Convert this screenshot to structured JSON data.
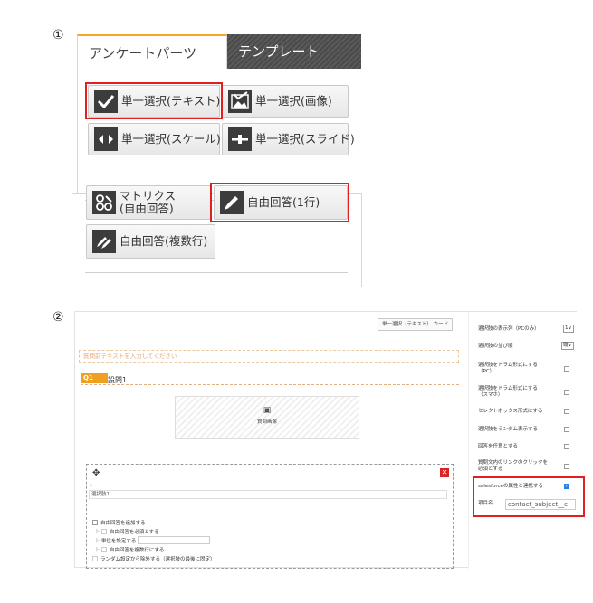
{
  "steps": [
    "①",
    "②"
  ],
  "part_panel": {
    "tabs": [
      {
        "label": "アンケートパーツ",
        "active": true
      },
      {
        "label": "テンプレート",
        "active": false
      }
    ],
    "parts": [
      {
        "label": "単一選択(テキスト)",
        "icon": "check-icon"
      },
      {
        "label": "単一選択(画像)",
        "icon": "image-check-icon"
      },
      {
        "label": "単一選択(スケール)",
        "icon": "scale-icon"
      },
      {
        "label": "単一選択(スライド)",
        "icon": "slider-icon"
      },
      {
        "label_line1": "マトリクス",
        "label_line2": "(自由回答)",
        "icon": "matrix-icon"
      },
      {
        "label": "自由回答(1行)",
        "icon": "pen-icon"
      },
      {
        "label": "自由回答(複数行)",
        "icon": "pens-icon"
      }
    ],
    "highlight_color": "#e02020"
  },
  "editor": {
    "type_button": "単一選択（テキスト） カード",
    "pre_text_placeholder": "質問前テキストを入力してください",
    "question_badge": "Q1",
    "question_title": "設問1",
    "question_image_label": "質問画像",
    "choice_number": "1",
    "choice_value": "選択肢1",
    "options": {
      "add_free": "自由回答を追加する",
      "free_required": "自由回答を必須とする",
      "set_unit": "単位を設定する",
      "free_multiline": "自由回答を複数行にする",
      "exclude_random": "ランダム設定から除外する（選択肢の最後に固定）",
      "prefix": "|-"
    }
  },
  "settings": {
    "rows": [
      {
        "label": "選択肢の表示列（PCのみ）",
        "select": "1",
        "chevron": "∨"
      },
      {
        "label": "選択肢の並び順",
        "select": "縦",
        "chevron": "∨"
      },
      {
        "label": "選択肢をドラム形式にする（PC）",
        "checked": false
      },
      {
        "label": "選択肢をドラム形式にする（スマホ）",
        "checked": false
      },
      {
        "label": "セレクトボックス形式にする",
        "checked": false
      },
      {
        "label": "選択肢をランダム表示する",
        "checked": false
      },
      {
        "label": "回答を任意とする",
        "checked": false
      },
      {
        "label": "質問文内のリンクのクリックを必須とする",
        "checked": false
      },
      {
        "label": "salesforceの属性と連携する",
        "checked": true
      }
    ],
    "item_name_label": "項目名",
    "item_name_value": "contact_subject__c"
  }
}
